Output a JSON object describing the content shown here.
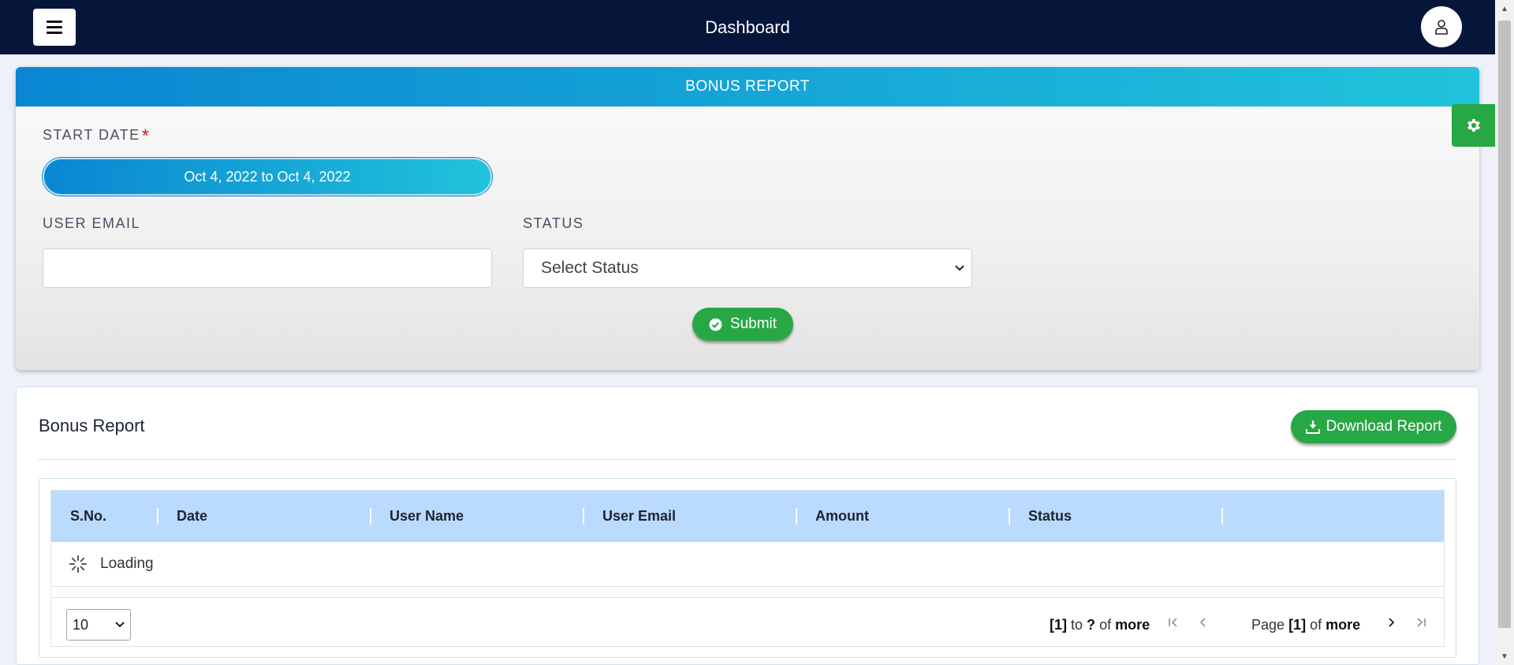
{
  "topbar": {
    "title": "Dashboard",
    "menu_icon": "hamburger-icon",
    "user_icon": "user-icon",
    "background": "#06163a"
  },
  "filter": {
    "header": "BONUS REPORT",
    "start_date_label": "START DATE",
    "required_mark": "*",
    "date_range_value": "Oct 4, 2022 to Oct 4, 2022",
    "user_email_label": "USER EMAIL",
    "user_email_value": "",
    "status_label": "STATUS",
    "status_selected": "Select Status",
    "submit_label": "Submit",
    "submit_icon": "check-circle-icon",
    "settings_icon": "gear-icon"
  },
  "report": {
    "title": "Bonus Report",
    "download_label": "Download Report",
    "download_icon": "download-icon",
    "columns": [
      "S.No.",
      "Date",
      "User Name",
      "User Email",
      "Amount",
      "Status"
    ],
    "loading_text": "Loading",
    "pagination": {
      "page_size": "10",
      "range_from": "[1]",
      "range_to_word": "to",
      "range_to": "?",
      "range_of_word": "of",
      "range_total": "more",
      "page_word": "Page",
      "current_page": "[1]",
      "page_of_word": "of",
      "page_total": "more"
    }
  },
  "colors": {
    "accent_gradient_start": "#0a86d2",
    "accent_gradient_end": "#21c3db",
    "success": "#28a745",
    "table_header": "#badafe",
    "required": "#c81e1e"
  }
}
